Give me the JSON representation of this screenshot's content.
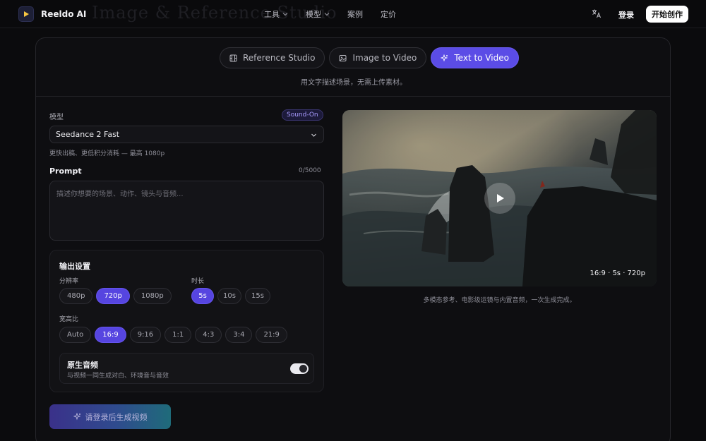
{
  "nav": {
    "brand": "Reeldo AI",
    "background_title": "Image & Reference Studio",
    "items": [
      {
        "label": "工具",
        "has_dropdown": true
      },
      {
        "label": "模型",
        "has_dropdown": true
      },
      {
        "label": "案例",
        "has_dropdown": false
      },
      {
        "label": "定价",
        "has_dropdown": false
      }
    ],
    "translate_icon": "translate-icon",
    "login": "登录",
    "start": "开始创作"
  },
  "tabs": [
    {
      "label": "Reference Studio",
      "icon": "film-icon",
      "active": false
    },
    {
      "label": "Image to Video",
      "icon": "image-icon",
      "active": false
    },
    {
      "label": "Text to Video",
      "icon": "sparkle-icon",
      "active": true
    }
  ],
  "subtitle": "用文字描述场景，无需上传素材。",
  "model": {
    "label": "模型",
    "badge": "Sound-On",
    "selected": "Seedance 2 Fast",
    "hint": "更快出稿、更低积分消耗 — 最高 1080p"
  },
  "prompt": {
    "label": "Prompt",
    "counter": "0/5000",
    "placeholder": "描述你想要的场景、动作、镜头与音频..."
  },
  "output": {
    "title": "输出设置",
    "resolution": {
      "label": "分辨率",
      "options": [
        "480p",
        "720p",
        "1080p"
      ],
      "selected": "720p"
    },
    "duration": {
      "label": "时长",
      "options": [
        "5s",
        "10s",
        "15s"
      ],
      "selected": "5s"
    },
    "aspect": {
      "label": "宽高比",
      "options": [
        "Auto",
        "16:9",
        "9:16",
        "1:1",
        "4:3",
        "3:4",
        "21:9"
      ],
      "selected": "16:9"
    },
    "sound": {
      "title": "原生音频",
      "desc": "与视频一同生成对白、环境音与音效",
      "enabled": true
    }
  },
  "generate_button": "请登录后生成视频",
  "preview": {
    "meta": "16:9 · 5s · 720p",
    "caption": "多模态参考、电影级运镜与内置音频，一次生成完成。"
  },
  "colors": {
    "accent": "#5b4ce6",
    "background": "#0b0b0d"
  }
}
